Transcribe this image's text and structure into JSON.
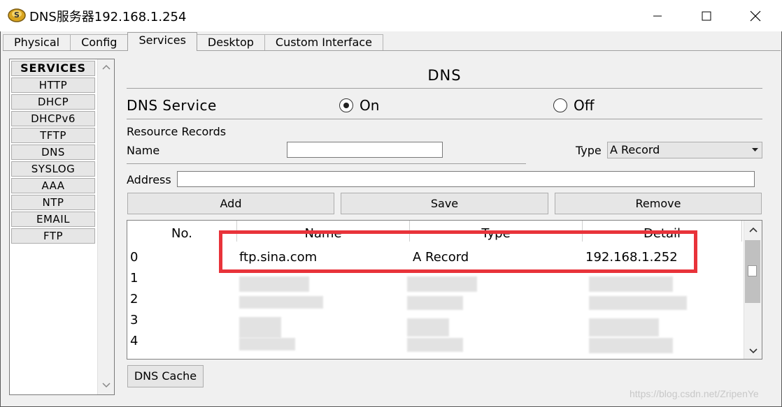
{
  "window": {
    "title": "DNS服务器192.168.1.254",
    "icons": {
      "app": "packet-tracer-server-icon",
      "minimize": "minimize-icon",
      "maximize": "maximize-icon",
      "close": "close-icon"
    }
  },
  "tabs": [
    {
      "label": "Physical",
      "active": false
    },
    {
      "label": "Config",
      "active": false
    },
    {
      "label": "Services",
      "active": true
    },
    {
      "label": "Desktop",
      "active": false
    },
    {
      "label": "Custom Interface",
      "active": false
    }
  ],
  "sidebar": {
    "header": "SERVICES",
    "items": [
      "HTTP",
      "DHCP",
      "DHCPv6",
      "TFTP",
      "DNS",
      "SYSLOG",
      "AAA",
      "NTP",
      "EMAIL",
      "FTP"
    ]
  },
  "dns": {
    "title": "DNS",
    "service_label": "DNS Service",
    "on_label": "On",
    "off_label": "Off",
    "service_state": "On",
    "resource_records_label": "Resource Records",
    "name_label": "Name",
    "name_value": "",
    "type_label": "Type",
    "type_value": "A Record",
    "address_label": "Address",
    "address_value": "",
    "add_label": "Add",
    "save_label": "Save",
    "remove_label": "Remove",
    "cache_label": "DNS Cache"
  },
  "table": {
    "columns": [
      "No.",
      "Name",
      "Type",
      "Detail"
    ],
    "rows": [
      {
        "no": "0",
        "name": "ftp.sina.com",
        "type": "A Record",
        "detail": "192.168.1.252"
      },
      {
        "no": "1",
        "name": "",
        "type": "",
        "detail": ""
      },
      {
        "no": "2",
        "name": "",
        "type": "",
        "detail": ""
      },
      {
        "no": "3",
        "name": "",
        "type": "",
        "detail": ""
      },
      {
        "no": "4",
        "name": "",
        "type": "",
        "detail": ""
      }
    ]
  },
  "colors": {
    "highlight": "#e8333a",
    "frame": "#f0f0f0",
    "button": "#e6e6e6"
  },
  "watermark": "https://blog.csdn.net/ZripenYe"
}
